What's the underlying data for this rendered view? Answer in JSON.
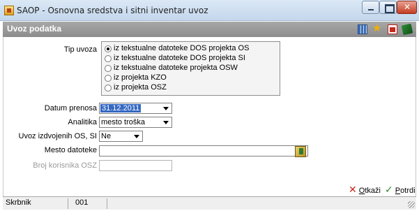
{
  "window": {
    "title": "SAOP -  Osnovna sredstva i sitni inventar uvoz",
    "header": "Uvoz podatka"
  },
  "form": {
    "tip_uvoza_label": "Tip uvoza",
    "options": [
      {
        "label": "iz tekstualne datoteke DOS projekta OS",
        "selected": true
      },
      {
        "label": "iz tekstualne datoteke DOS projekta SI",
        "selected": false
      },
      {
        "label": "iz tekstualne datoteke  projekta OSW",
        "selected": false
      },
      {
        "label": "iz projekta KZO",
        "selected": false
      },
      {
        "label": "iz projekta OSZ",
        "selected": false
      }
    ],
    "datum_label": "Datum prenosa",
    "datum_value": "31.12.2011",
    "analitika_label": "Analitika",
    "analitika_value": "mesto troška",
    "uvoz_label": "Uvoz izdvojenih OS, SI",
    "uvoz_value": "Ne",
    "mesto_label": "Mesto datoteke",
    "mesto_value": "",
    "broj_label": "Broj korisnika OSZ",
    "broj_value": ""
  },
  "actions": {
    "cancel": {
      "first": "O",
      "rest": "tkaži"
    },
    "confirm": {
      "first": "P",
      "rest": "otrdi"
    }
  },
  "status": {
    "user": "Skrbnik",
    "code": "001"
  },
  "icons": [
    "table-icon",
    "star-icon",
    "pdf-icon",
    "book-icon",
    "browse-folder-icon"
  ]
}
